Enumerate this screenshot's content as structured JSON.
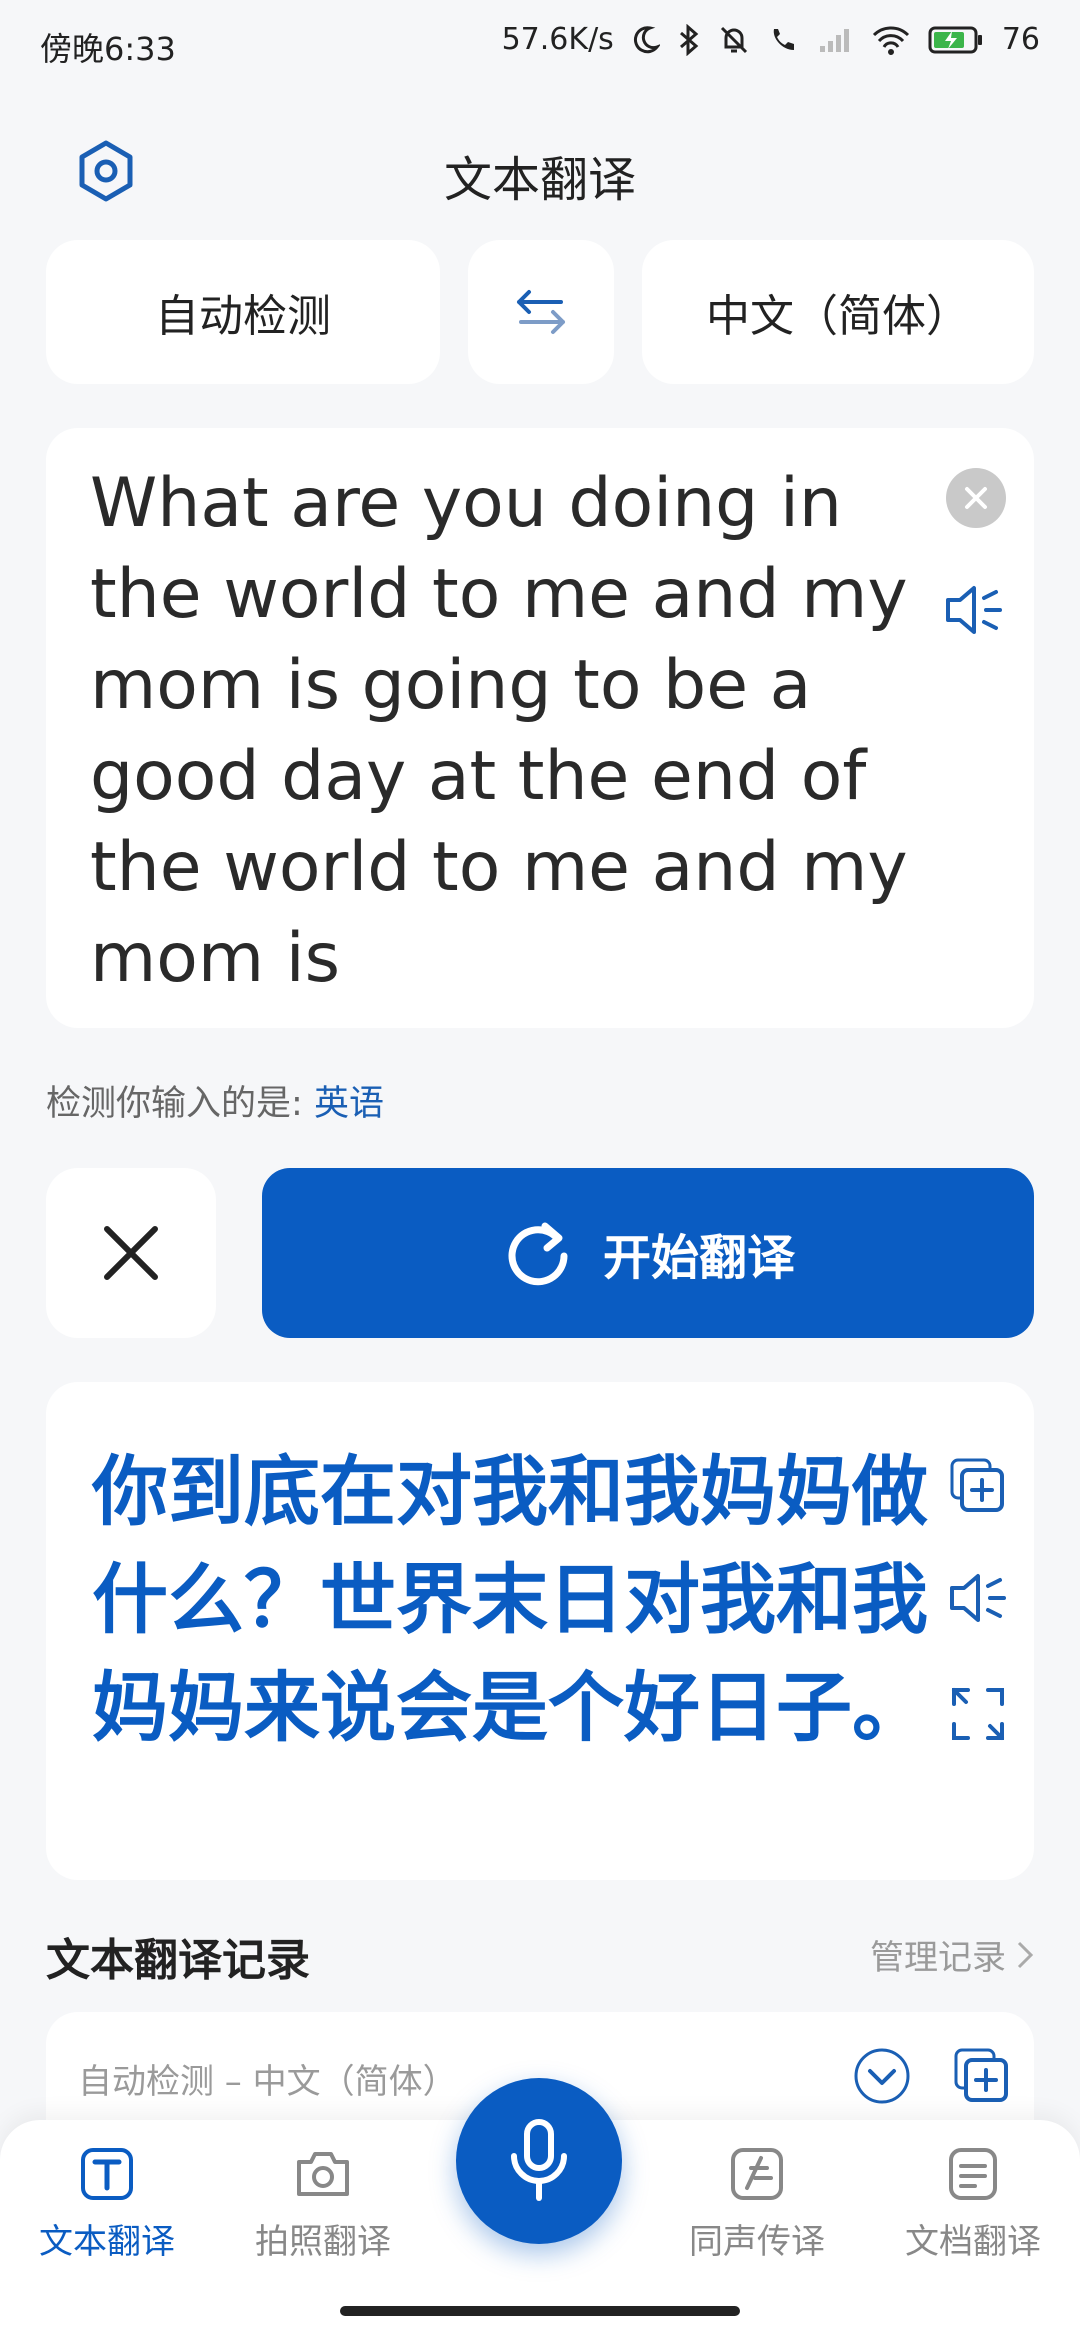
{
  "status_bar": {
    "time": "傍晚6:33",
    "network_speed": "57.6K/s",
    "battery": "76"
  },
  "header": {
    "title": "文本翻译",
    "settings_icon": "settings-hexagon-icon"
  },
  "languages": {
    "source": "自动检测",
    "target": "中文（简体）",
    "swap_icon": "swap-arrows-icon"
  },
  "input": {
    "text": "What are you doing in the world to me and my mom is going to be a good day at the end of the world to me and my mom is"
  },
  "detection": {
    "label": "检测你输入的是:",
    "language": "英语"
  },
  "actions": {
    "translate_label": "开始翻译"
  },
  "output": {
    "text": "你到底在对我和我妈妈做什么？世界末日对我和我妈妈来说会是个好日子。"
  },
  "history": {
    "title": "文本翻译记录",
    "manage_label": "管理记录",
    "item_lang": "自动检测 – 中文（简体）"
  },
  "bottom_nav": {
    "items": [
      {
        "label": "文本翻译",
        "icon": "text-t-icon"
      },
      {
        "label": "拍照翻译",
        "icon": "camera-icon"
      },
      {
        "label": "同声传译",
        "icon": "simultaneous-icon"
      },
      {
        "label": "文档翻译",
        "icon": "document-icon"
      }
    ],
    "mic_icon": "microphone-icon"
  },
  "colors": {
    "accent": "#0a5cc2",
    "background": "#f6f7f9",
    "card": "#ffffff"
  }
}
